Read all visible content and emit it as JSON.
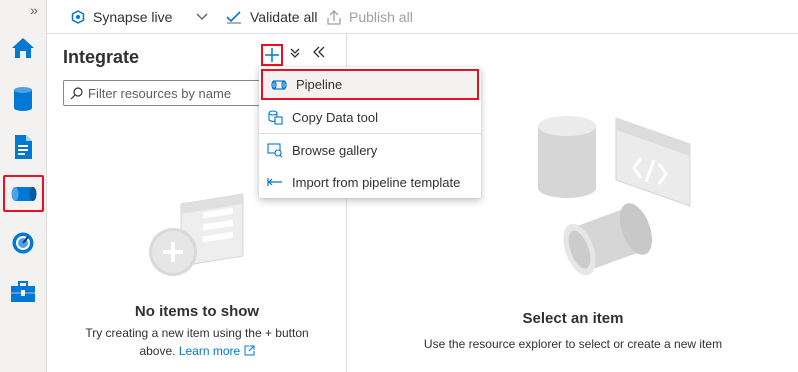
{
  "rail": {
    "expand_icon": "double-chevron-right",
    "items": [
      {
        "name": "home",
        "icon": "home-icon"
      },
      {
        "name": "data",
        "icon": "database-icon"
      },
      {
        "name": "develop",
        "icon": "document-icon"
      },
      {
        "name": "integrate",
        "icon": "pipeline-icon",
        "selected": true
      },
      {
        "name": "monitor",
        "icon": "gauge-icon"
      },
      {
        "name": "manage",
        "icon": "toolbox-icon"
      }
    ]
  },
  "toolbar": {
    "workspace_label": "Synapse live",
    "validate_label": "Validate all",
    "publish_label": "Publish all"
  },
  "integrate": {
    "title": "Integrate",
    "filter_placeholder": "Filter resources by name",
    "empty_title": "No items to show",
    "empty_desc": "Try creating a new item using the + button above.",
    "learn_more": "Learn more"
  },
  "menu": {
    "items": [
      {
        "label": "Pipeline",
        "icon": "pipeline-icon"
      },
      {
        "label": "Copy Data tool",
        "icon": "copy-data-icon"
      },
      {
        "label": "Browse gallery",
        "icon": "gallery-icon"
      },
      {
        "label": "Import from pipeline template",
        "icon": "import-icon"
      }
    ]
  },
  "main": {
    "title": "Select an item",
    "desc": "Use the resource explorer to select or create a new item"
  },
  "colors": {
    "accent": "#0078d4",
    "highlight_border": "#e81123",
    "rail_bg": "#f3f2f1"
  }
}
